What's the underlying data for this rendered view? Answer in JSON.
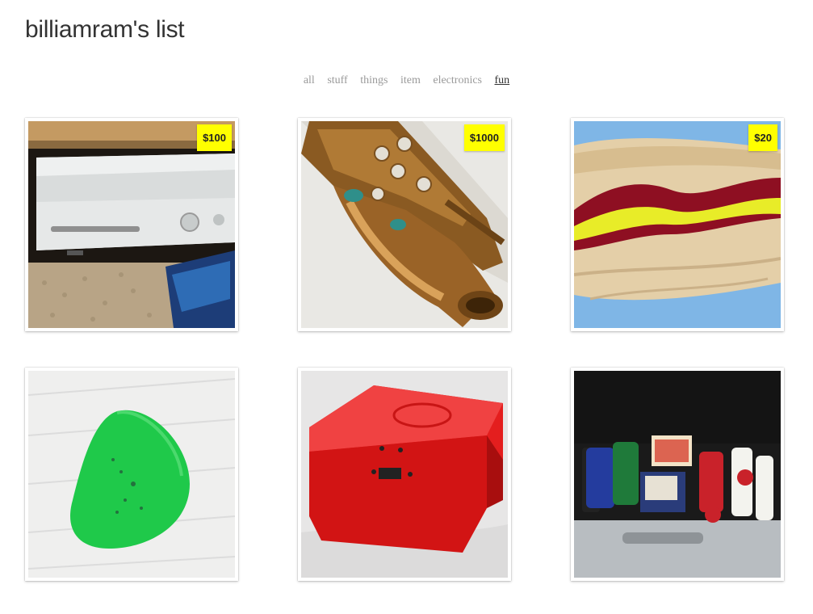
{
  "page": {
    "title": "billiamram's list"
  },
  "filters": [
    {
      "label": "all",
      "active": false
    },
    {
      "label": "stuff",
      "active": false
    },
    {
      "label": "things",
      "active": false
    },
    {
      "label": "item",
      "active": false
    },
    {
      "label": "electronics",
      "active": false
    },
    {
      "label": "fun",
      "active": true
    }
  ],
  "items": [
    {
      "image": "game-console",
      "price": "$100"
    },
    {
      "image": "saxophone",
      "price": "$1000"
    },
    {
      "image": "hot-dog-costume",
      "price": "$20"
    },
    {
      "image": "guitar-pick",
      "price": ""
    },
    {
      "image": "red-lockbox",
      "price": ""
    },
    {
      "image": "poker-chip-case",
      "price": ""
    }
  ],
  "colors": {
    "price_tag": "#ffff00",
    "title": "#333333",
    "nav": "#9a9a9a",
    "nav_active": "#333333"
  }
}
